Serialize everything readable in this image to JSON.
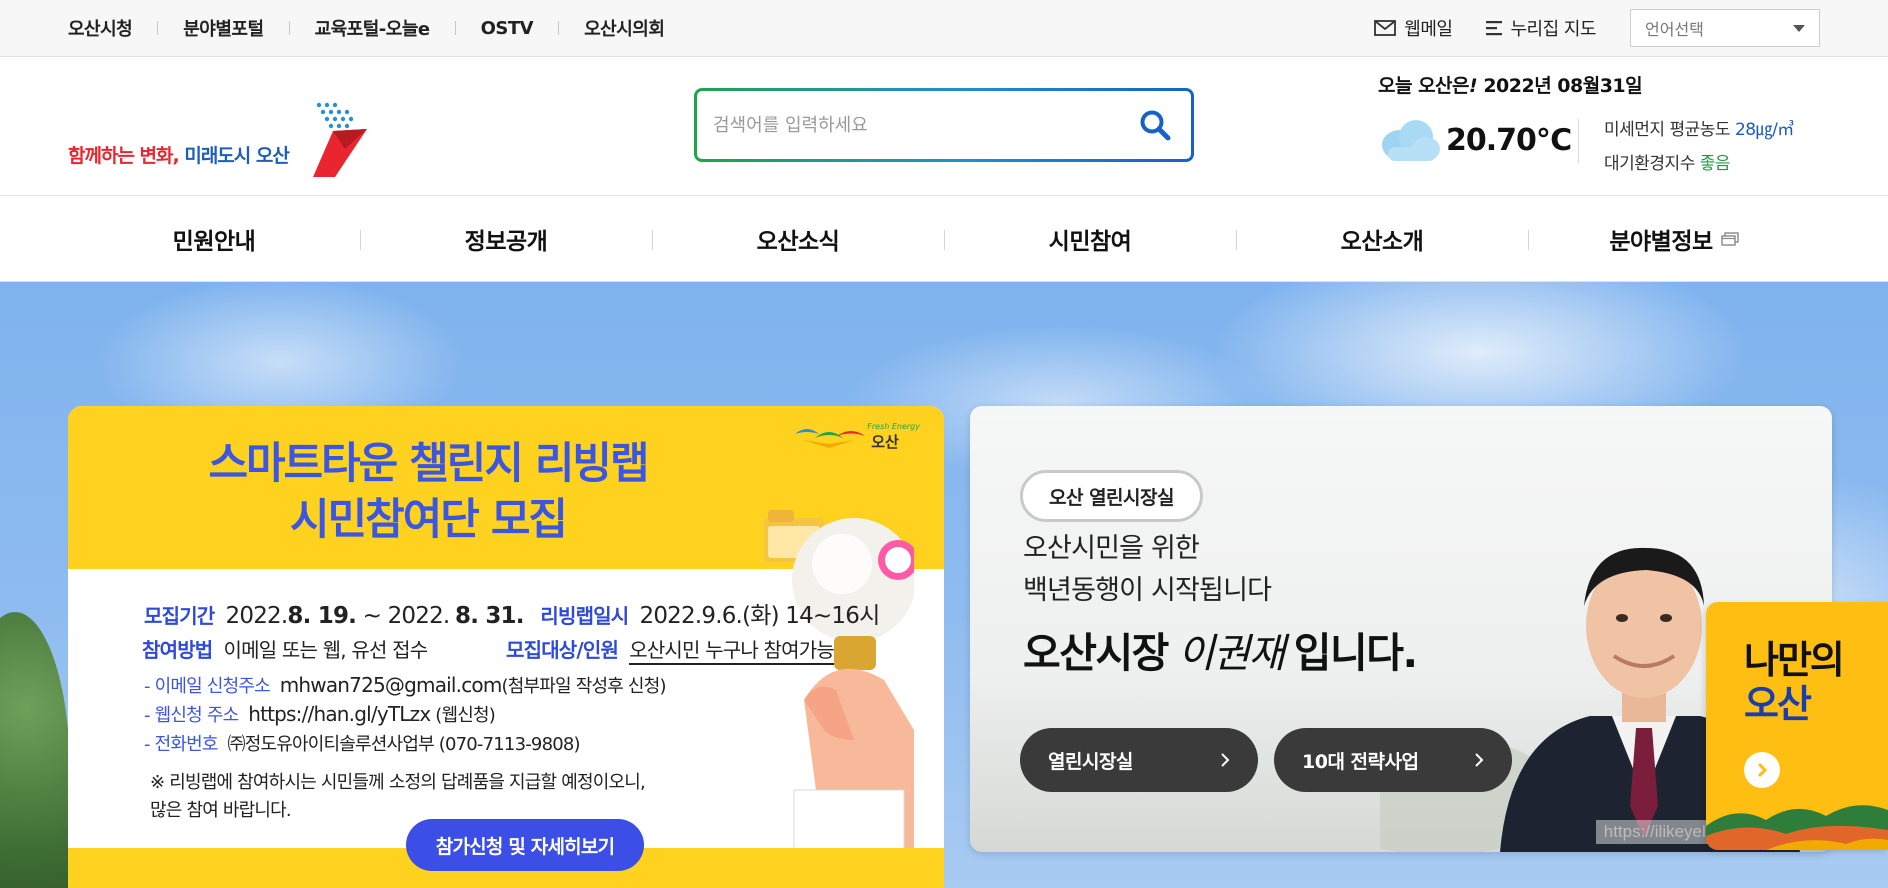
{
  "topbar": {
    "links": [
      "오산시청",
      "분야별포털",
      "교육포털-오늘e",
      "OSTV",
      "오산시의회"
    ],
    "webmail": "웹메일",
    "sitemap": "누리집 지도",
    "language": "언어선택"
  },
  "header": {
    "logo_text": "함께하는 변화, 미래도시 오산",
    "logo_part1": "함께하는 변화,",
    "logo_part2": "미래도시 오산",
    "search_placeholder": "검색어를 입력하세요",
    "weather": {
      "today_label": "오늘 오산은",
      "exclaim": "!",
      "date": "2022년 08월31일",
      "temperature": "20.70℃",
      "fine_dust_label": "미세먼지 평균농도",
      "fine_dust_value": "28㎍/㎥",
      "air_index_label": "대기환경지수",
      "air_index_value": "좋음",
      "icon": "cloud-icon"
    }
  },
  "gnb": {
    "items": [
      "민원안내",
      "정보공개",
      "오산소식",
      "시민참여",
      "오산소개",
      "분야별정보"
    ]
  },
  "banner_left": {
    "logo_mini_en": "Fresh Energy",
    "logo_mini_kr": "오산",
    "headline1": "스마트타운 챌린지 리빙랩",
    "headline2": "시민참여단 모집",
    "period_label": "모집기간",
    "period_start_prefix": "2022.",
    "period_start_bold": "8. 19.",
    "period_tilde": " ~ 2022.",
    "period_end_bold": "8. 31.",
    "livinglab_label": "리빙랩일시",
    "livinglab_value": "2022.9.6.(화) 14~16시",
    "method_label": "참여방법",
    "method_value": "이메일 또는 웹, 유선 접수",
    "target_label": "모집대상/인원",
    "target_value": "오산시민 누구나 참여가능",
    "email_label": "- 이메일 신청주소",
    "email_value": "mhwan725@gmail.com",
    "email_note": "(첨부파일 작성후 신청)",
    "web_label": "- 웹신청 주소",
    "web_value": "https://han.gl/yTLzx",
    "web_note": "(웹신청)",
    "phone_label": "- 전화번호",
    "phone_value": "㈜정도유아이티솔루션사업부 (070-7113-9808)",
    "notice1": "※ 리빙랩에 참여하시는 시민들께 소정의 답례품을 지급할 예정이오니,",
    "notice2": "많은 참여 바랍니다.",
    "cta": "참가신청 및 자세히보기"
  },
  "banner_right": {
    "pill": "오산 열린시장실",
    "msg1": "오산시민을 위한",
    "msg2": "백년동행이 시작됩니다",
    "mayor_prefix": "오산시장",
    "mayor_signature": "이권재",
    "mayor_suffix": "입니다.",
    "btn1": "열린시장실",
    "btn2": "10대 전략사업",
    "watermark": "https://ilikeyellow.tistory.com"
  },
  "side_widget": {
    "line1": "나만의",
    "line2": "오산"
  },
  "colors": {
    "brand_blue": "#1b5fb8",
    "brand_red": "#e9262f",
    "banner_yellow": "#ffd21f",
    "banner_blue": "#3b56e0",
    "widget_yellow": "#ffbf12",
    "search_green": "#1fa54a",
    "search_blue": "#1762c4"
  }
}
